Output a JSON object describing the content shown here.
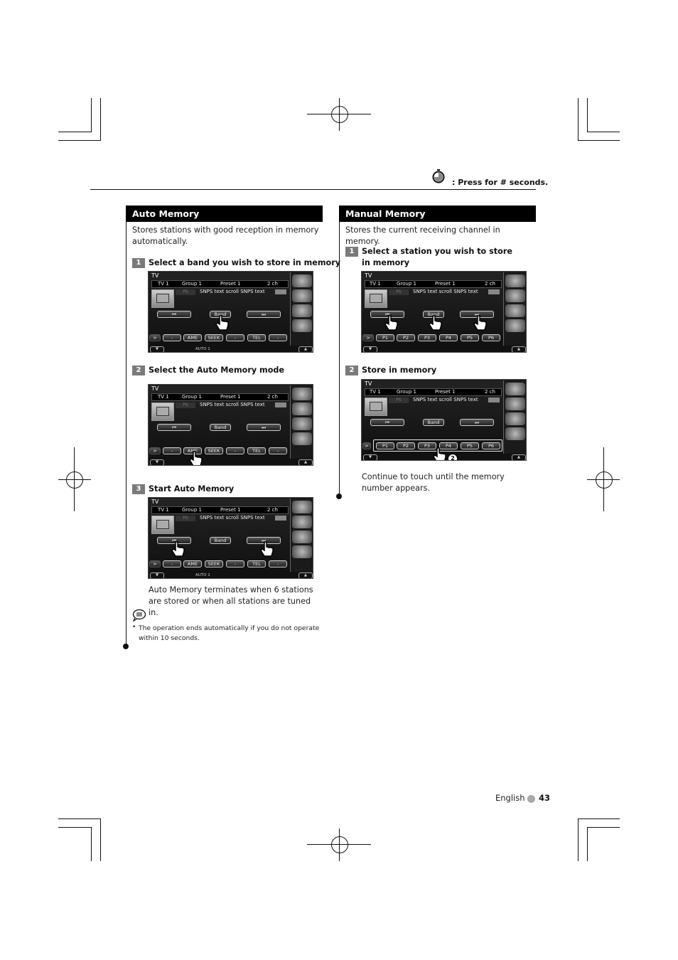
{
  "header": {
    "legend_icon": "stopwatch-icon",
    "legend_text": ": Press for # seconds."
  },
  "auto_memory": {
    "title": "Auto Memory",
    "description": "Stores stations with good reception in memory automatically.",
    "steps": [
      {
        "num": "1",
        "text": "Select a band you wish to store in memory"
      },
      {
        "num": "2",
        "text": "Select the Auto Memory mode"
      },
      {
        "num": "3",
        "text": "Start Auto Memory"
      }
    ],
    "after_text": "Auto Memory terminates when 6 stations are stored or when all stations are tuned in.",
    "note_icon": "note-icon",
    "note_text": "The operation ends automatically if you do not operate within 10 seconds."
  },
  "manual_memory": {
    "title": "Manual Memory",
    "description": "Stores the current receiving channel in memory.",
    "steps": [
      {
        "num": "1",
        "text": "Select a station you wish to store in memory"
      },
      {
        "num": "2",
        "text": "Store in memory"
      }
    ],
    "after_text": "Continue to touch until the memory number appears."
  },
  "screen": {
    "title": "TV",
    "band": "TV 1",
    "group": "Group 1",
    "preset": "Preset 1",
    "channel": "2 ch",
    "ps_label": "PS",
    "scroll_text": "SNPS text scroll SNPS text",
    "prev_label": "⏮",
    "band_label": "Band",
    "next_label": "⏭",
    "func_buttons": [
      "-",
      "AME",
      "SEEK",
      "-",
      "TEL",
      "-"
    ],
    "preset_buttons": [
      "P1",
      "P2",
      "P3",
      "P4",
      "P5",
      "P6"
    ],
    "more_label": ">",
    "status_text": "AUTO 1",
    "hold_seconds": "2"
  },
  "footer": {
    "language": "English",
    "page_number": "43"
  }
}
